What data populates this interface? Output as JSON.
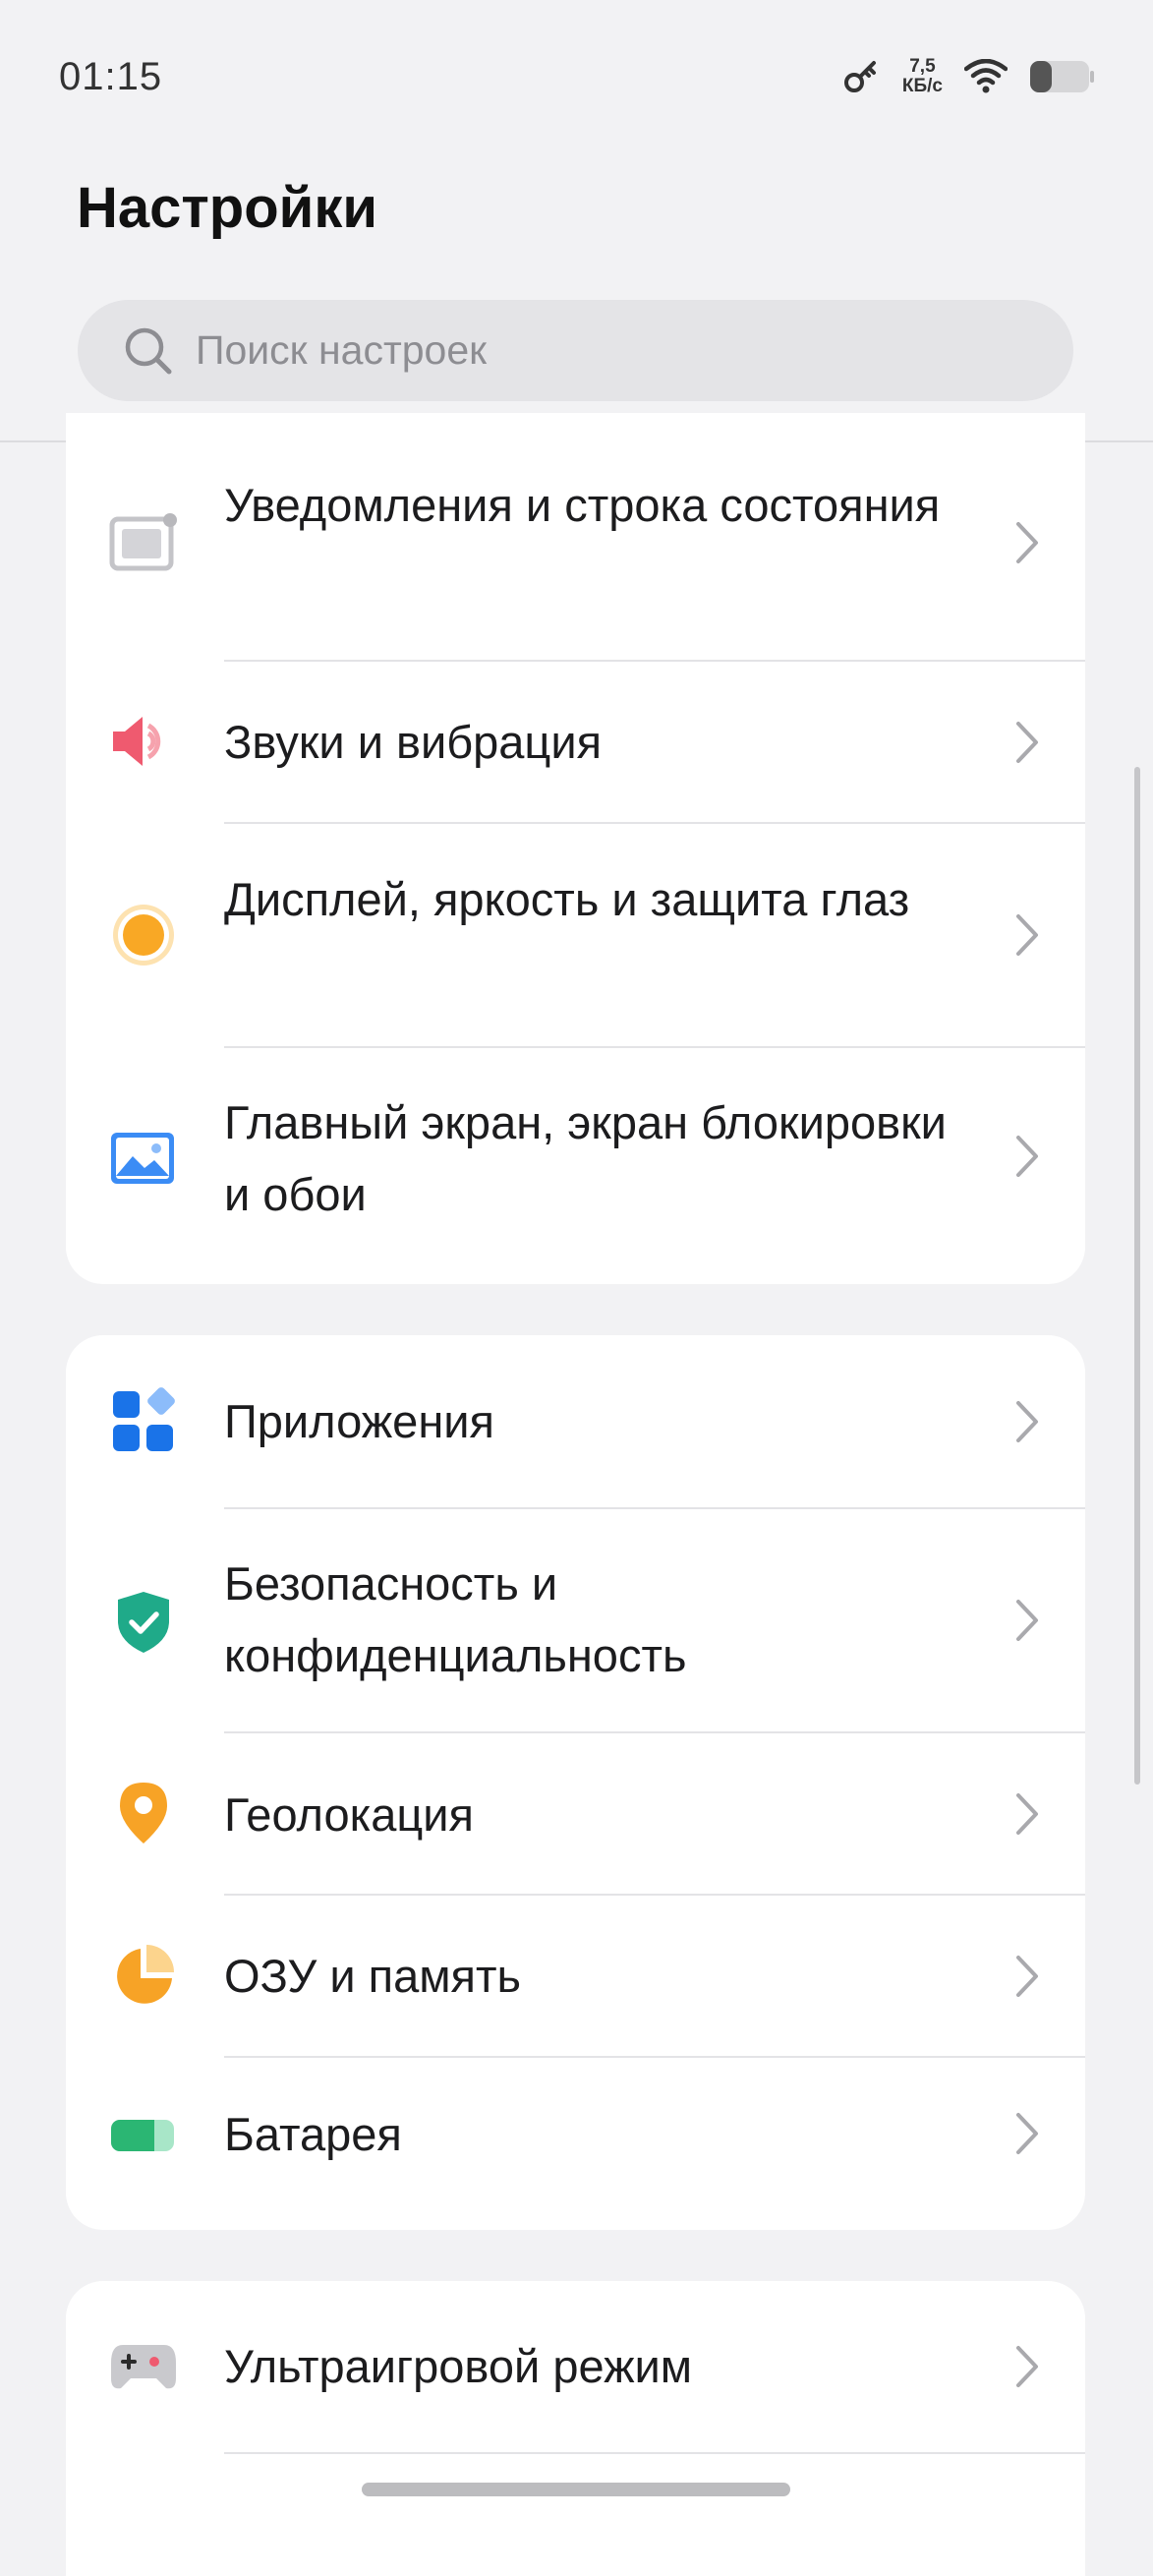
{
  "status_bar": {
    "time": "01:15",
    "net_speed_value": "7,5",
    "net_speed_unit": "КБ/с",
    "icons": [
      "key-icon",
      "wifi-icon",
      "battery-icon"
    ]
  },
  "header": {
    "title": "Настройки"
  },
  "search": {
    "placeholder": "Поиск настроек"
  },
  "groups": [
    {
      "items": [
        {
          "label": "Уведомления и строка состояния",
          "icon": "notification-bar-icon"
        },
        {
          "label": "Звуки и вибрация",
          "icon": "speaker-icon"
        },
        {
          "label": "Дисплей, яркость и защита глаз",
          "icon": "display-brightness-icon"
        },
        {
          "label": "Главный экран, экран блокировки и обои",
          "icon": "wallpaper-icon"
        }
      ]
    },
    {
      "items": [
        {
          "label": "Приложения",
          "icon": "apps-icon"
        },
        {
          "label": "Безопасность и конфиденциальность",
          "icon": "security-shield-icon"
        },
        {
          "label": "Геолокация",
          "icon": "location-pin-icon"
        },
        {
          "label": "ОЗУ и память",
          "icon": "storage-pie-icon"
        },
        {
          "label": "Батарея",
          "icon": "battery-setting-icon"
        }
      ]
    },
    {
      "items": [
        {
          "label": "Ультраигровой режим",
          "icon": "gamepad-icon"
        }
      ]
    }
  ],
  "colors": {
    "background": "#f2f2f4",
    "card": "#ffffff",
    "sound_icon": "#ef5a6f",
    "display_icon": "#f9a825",
    "wallpaper_icon": "#3b8cf5",
    "apps_icon": "#1a73e8",
    "security_icon": "#1faa89",
    "location_icon": "#f7a326",
    "storage_icon": "#f7a326",
    "battery_icon": "#2bb673"
  }
}
